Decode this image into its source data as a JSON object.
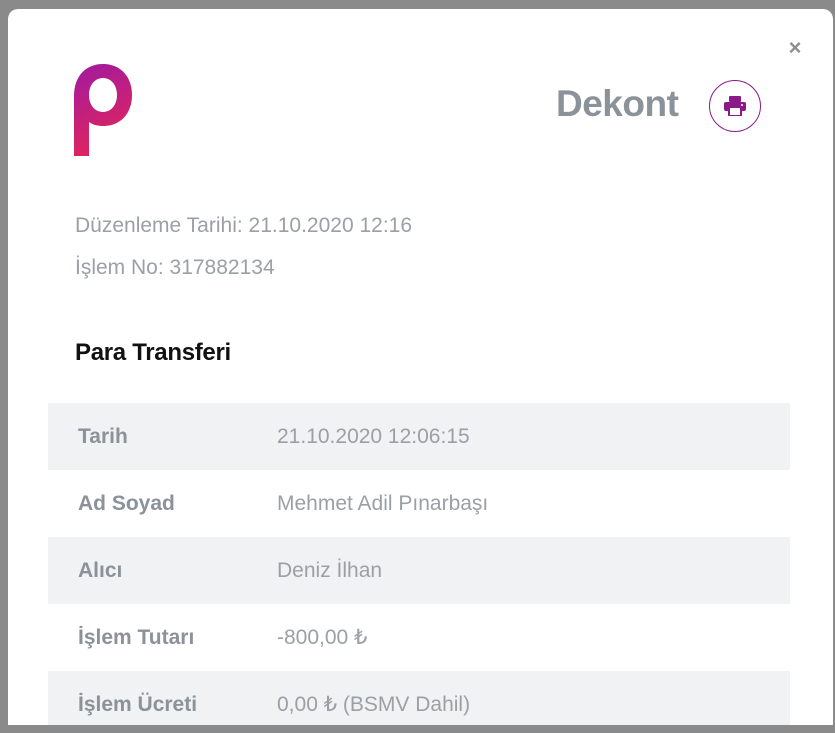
{
  "modal": {
    "close_label": "×",
    "title": "Dekont",
    "print_icon": "printer-icon",
    "logo_icon": "papara-logo"
  },
  "meta": {
    "issue_date_label": "Düzenleme Tarihi: 21.10.2020 12:16",
    "transaction_no_label": "İşlem No: 317882134"
  },
  "section_title": "Para Transferi",
  "details": [
    {
      "label": "Tarih",
      "value": "21.10.2020 12:06:15"
    },
    {
      "label": "Ad Soyad",
      "value": "Mehmet Adil Pınarbaşı"
    },
    {
      "label": "Alıcı",
      "value": "Deniz İlhan"
    },
    {
      "label": "İşlem Tutarı",
      "value": "-800,00 ₺"
    },
    {
      "label": "İşlem Ücreti",
      "value": "0,00 ₺ (BSMV Dahil)"
    }
  ],
  "colors": {
    "brand_gradient_start": "#a01aa0",
    "brand_gradient_end": "#e0245e",
    "print_border": "#8b1a89",
    "row_shade": "#f1f2f4"
  }
}
